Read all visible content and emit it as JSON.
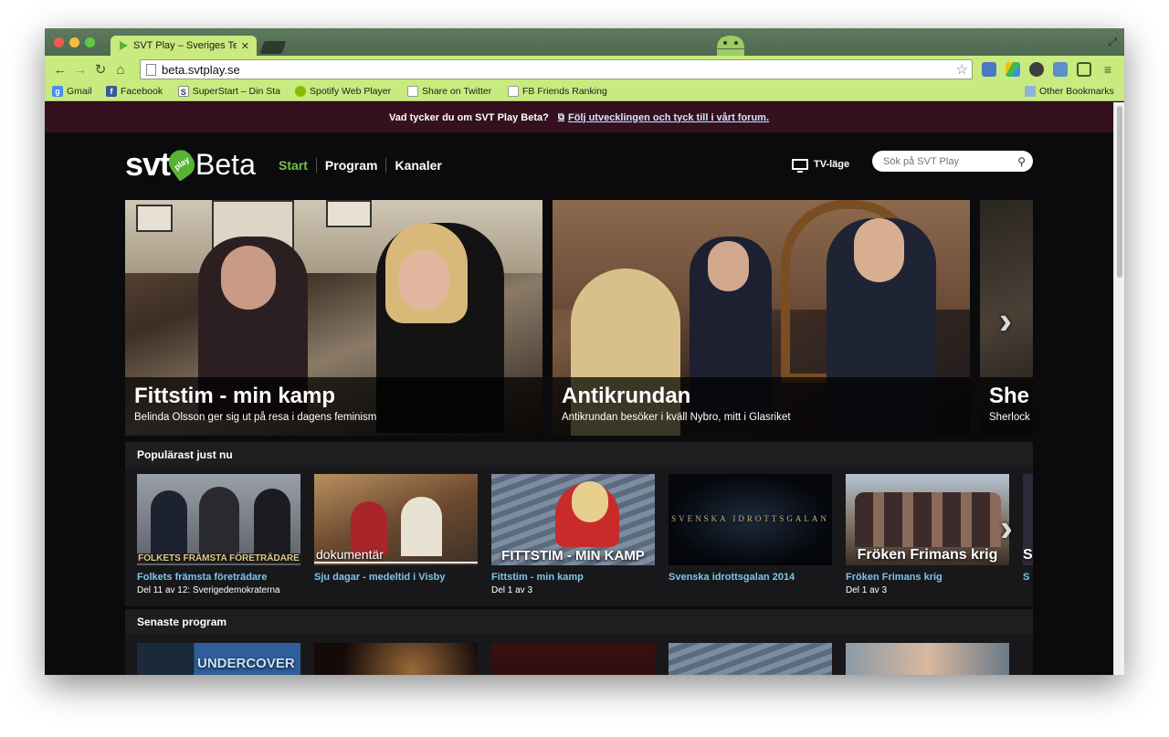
{
  "browser": {
    "tab_title": "SVT Play – Sveriges Televis",
    "url": "beta.svtplay.se",
    "bookmarks": [
      "Gmail",
      "Facebook",
      "SuperStart – Din Sta",
      "Spotify Web Player",
      "Share on Twitter",
      "FB Friends Ranking"
    ],
    "other_bookmarks": "Other Bookmarks"
  },
  "banner": {
    "question": "Vad tycker du om SVT Play Beta?",
    "link": "Följ utvecklingen och tyck till i vårt forum."
  },
  "header": {
    "logo_svt": "svt",
    "logo_play": "play",
    "logo_beta": "Beta",
    "nav": [
      "Start",
      "Program",
      "Kanaler"
    ],
    "tv_mode": "TV-läge",
    "search_placeholder": "Sök på SVT Play"
  },
  "hero": [
    {
      "title": "Fittstim - min kamp",
      "subtitle": "Belinda Olsson ger sig ut på resa i dagens feminism"
    },
    {
      "title": "Antikrundan",
      "subtitle": "Antikrundan besöker i kväll Nybro, mitt i Glasriket"
    },
    {
      "title": "She",
      "subtitle": "Sherlock"
    }
  ],
  "popular": {
    "heading": "Populärast just nu",
    "items": [
      {
        "title": "Folkets främsta företrädare",
        "subtitle": "Del 11 av 12: Sverigedemokraterna",
        "thumb_text": "FOLKETS FRÄMSTA FÖRETRÄDARE"
      },
      {
        "title": "Sju dagar - medeltid i Visby",
        "subtitle": "",
        "thumb_text": "dokumentär"
      },
      {
        "title": "Fittstim - min kamp",
        "subtitle": "Del 1 av 3",
        "thumb_text": "FITTSTIM - MIN KAMP"
      },
      {
        "title": "Svenska idrottsgalan 2014",
        "subtitle": "",
        "thumb_text": "SVENSKA IDROTTSGALAN"
      },
      {
        "title": "Fröken Frimans krig",
        "subtitle": "Del 1 av 3",
        "thumb_text": "Fröken Frimans krig"
      },
      {
        "title": "S",
        "subtitle": "",
        "thumb_text": "S"
      }
    ]
  },
  "latest": {
    "heading": "Senaste program",
    "items": [
      {
        "thumb_text": "UNDERCOVER"
      },
      {
        "thumb_text": ""
      },
      {
        "thumb_text": ""
      },
      {
        "thumb_text": ""
      },
      {
        "thumb_text": ""
      }
    ]
  },
  "colors": {
    "chrome_green": "#c8ea7e",
    "banner_bg": "#35101f",
    "accent_green": "#73c04a",
    "link_blue": "#7ec6e8"
  }
}
